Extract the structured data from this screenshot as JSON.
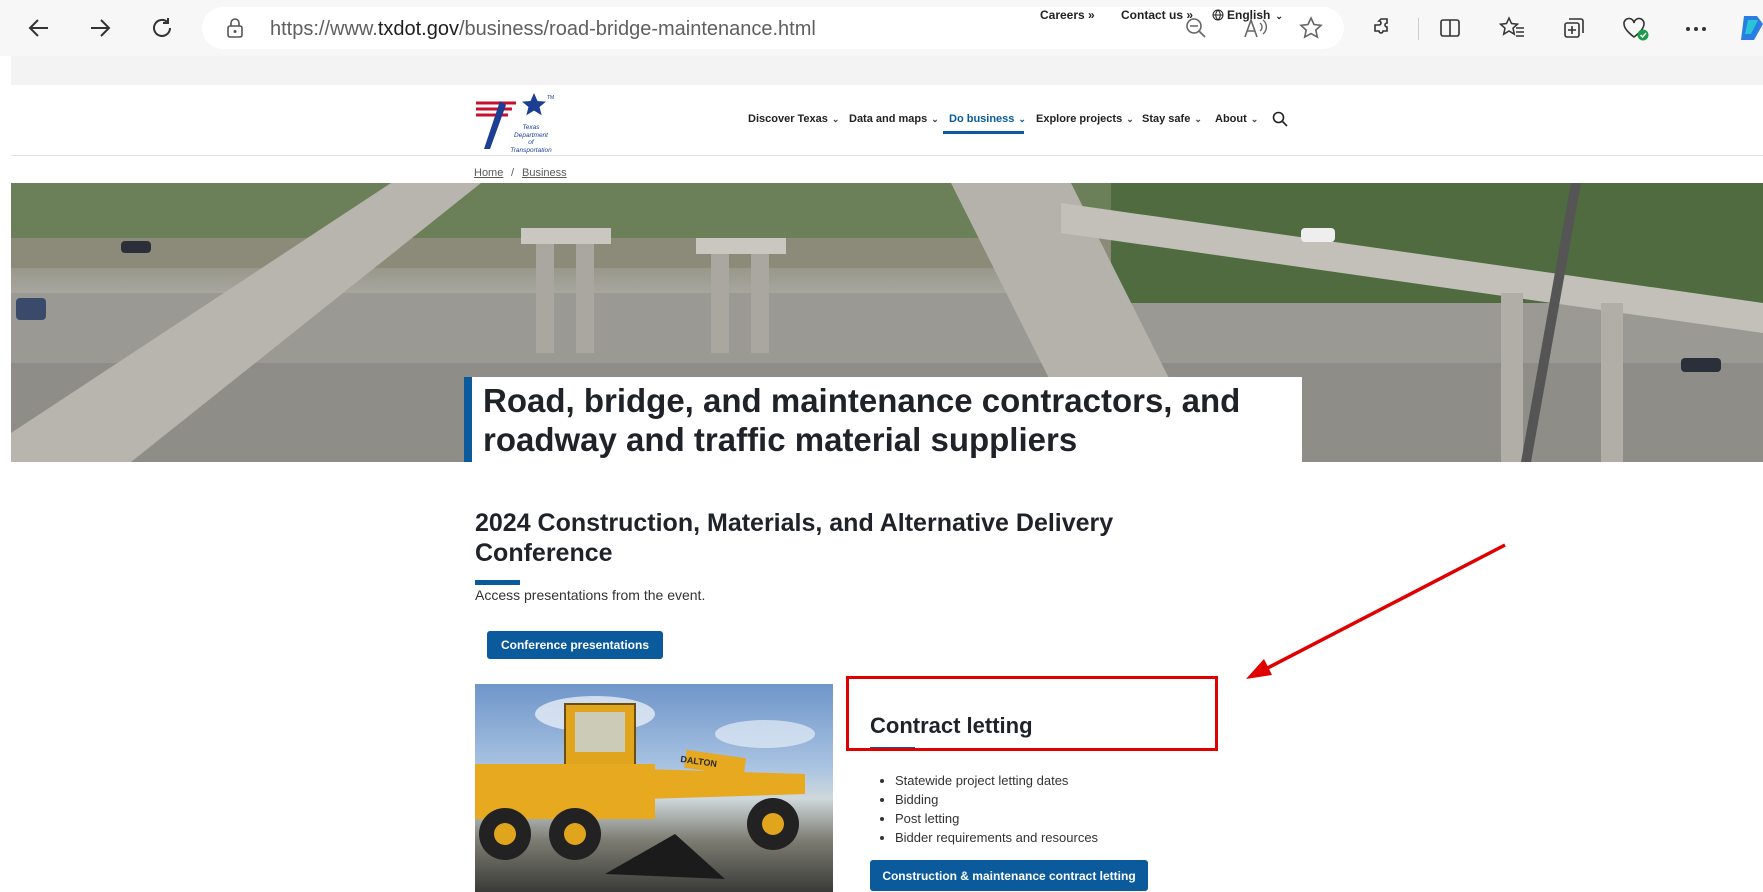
{
  "browser": {
    "url_prefix": "https://www.",
    "url_host": "txdot.gov",
    "url_path": "/business/road-bridge-maintenance.html"
  },
  "utility_bar": {
    "careers": "Careers »",
    "contact": "Contact us »",
    "language": "English"
  },
  "header": {
    "logo_text_1": "Texas",
    "logo_text_2": "Department",
    "logo_text_3": "of Transportation",
    "nav": [
      {
        "label": "Discover Texas"
      },
      {
        "label": "Data and maps"
      },
      {
        "label": "Do business",
        "active": true
      },
      {
        "label": "Explore projects"
      },
      {
        "label": "Stay safe"
      },
      {
        "label": "About"
      }
    ]
  },
  "breadcrumb": {
    "home": "Home",
    "separator": "/",
    "business": "Business"
  },
  "hero": {
    "title": "Road, bridge, and maintenance contractors, and roadway and traffic material suppliers"
  },
  "conference": {
    "title": "2024 Construction, Materials, and Alternative Delivery Conference",
    "description": "Access presentations from the event.",
    "button": "Conference presentations"
  },
  "contract_letting": {
    "title": "Contract letting",
    "items": [
      "Statewide project letting dates",
      "Bidding",
      "Post letting",
      "Bidder requirements and resources"
    ],
    "button": "Construction & maintenance contract letting"
  },
  "grader_image": {
    "brand_text": "DALTON"
  },
  "colors": {
    "accent_blue": "#0a5a9c",
    "annotation_red": "#e00000"
  }
}
